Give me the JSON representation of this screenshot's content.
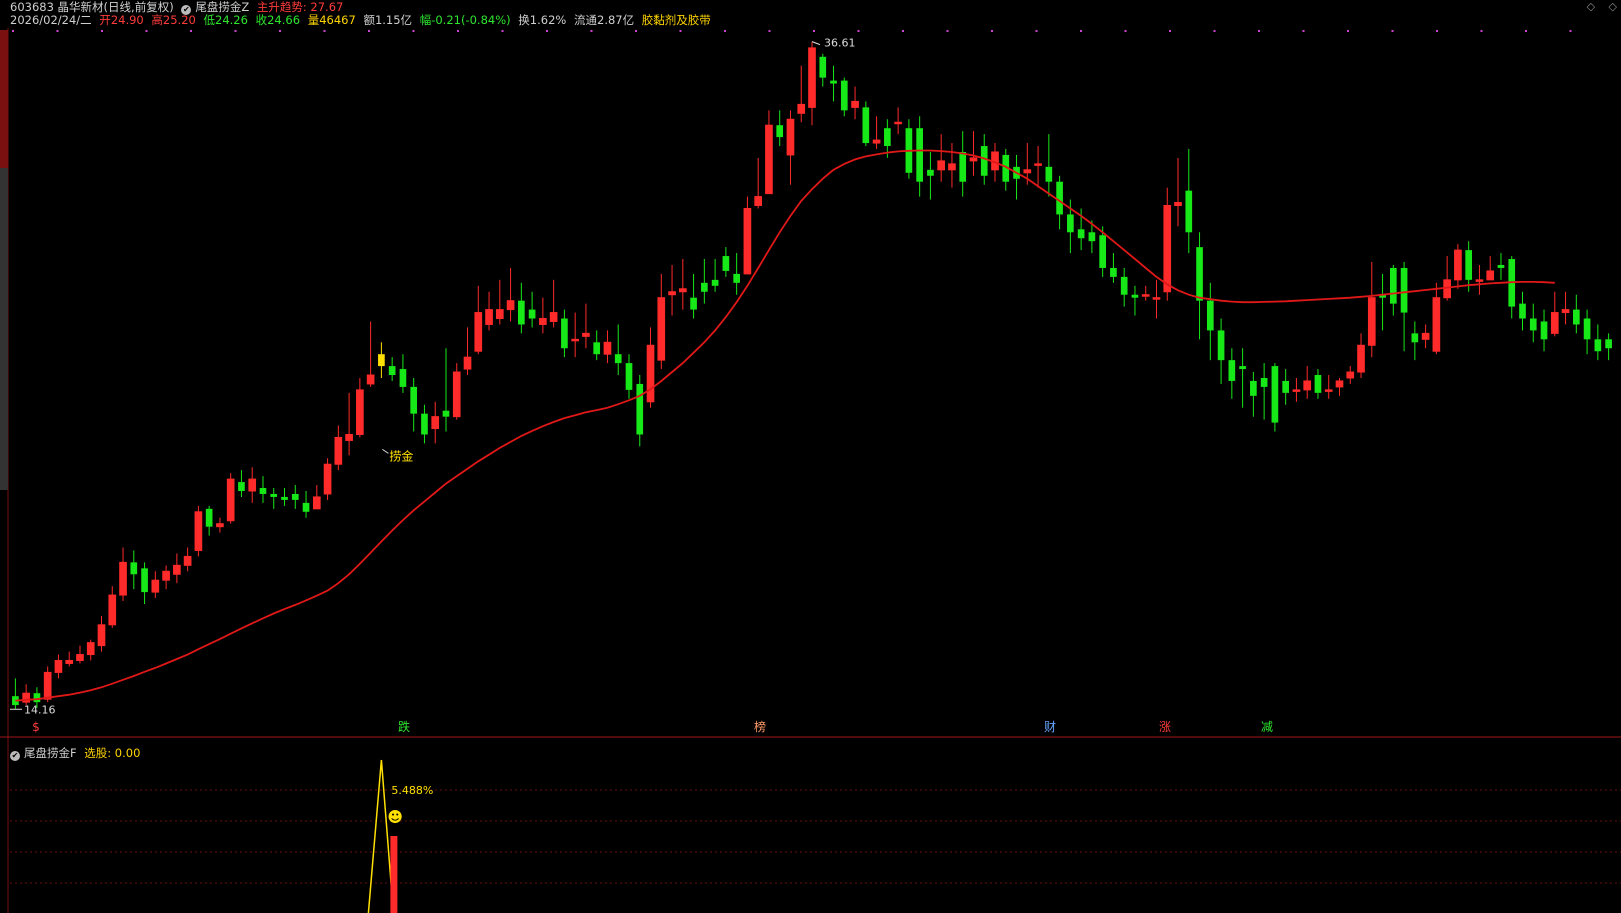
{
  "header": {
    "line1": {
      "code_name": "603683 晶华新材(日线,前复权)",
      "indicator": "尾盘捞金Z",
      "trend_label": "主升趋势: 27.67"
    },
    "line2": {
      "date": "2026/02/24/二",
      "open": "开24.90",
      "high": "高25.20",
      "low": "低24.26",
      "close": "收24.66",
      "volume": "量46467",
      "amount": "额1.15亿",
      "change": "幅-0.21(-0.84%)",
      "turnover": "换1.62%",
      "float": "流通2.87亿",
      "concept": "胶黏剂及胶带"
    }
  },
  "main_chart": {
    "max_label": "36.61",
    "min_label": "14.16",
    "signal_label": "捞金",
    "bottom_markers": [
      {
        "text": "$",
        "color": "#ff3b3b"
      },
      {
        "text": "跌",
        "color": "#2ee62e"
      },
      {
        "text": "榜",
        "color": "#ff9a66"
      },
      {
        "text": "财",
        "color": "#66a6ff"
      },
      {
        "text": "涨",
        "color": "#ff3b3b"
      },
      {
        "text": "减",
        "color": "#2ee62e"
      }
    ]
  },
  "sub_chart": {
    "title": "尾盘捞金F",
    "select_label": "选股: 0.00",
    "peak_label": "5.488%",
    "emoji": "☻"
  },
  "window_controls": [
    "◇",
    "◇"
  ],
  "colors": {
    "up": "#ff2a2a",
    "down": "#17e817",
    "ma": "#e01818",
    "signal": "#ffe000",
    "bg": "#000000"
  },
  "chart_data": {
    "type": "candlestick",
    "ma_label": "",
    "candles": [
      [
        14.6,
        14.3,
        15.2,
        14.16
      ],
      [
        14.4,
        14.7,
        15.0,
        14.3
      ],
      [
        14.7,
        14.4,
        14.9,
        14.2
      ],
      [
        14.5,
        15.4,
        15.6,
        14.4
      ],
      [
        15.4,
        15.8,
        16.0,
        15.2
      ],
      [
        15.7,
        15.8,
        16.1,
        15.6
      ],
      [
        15.8,
        16.0,
        16.3,
        15.7
      ],
      [
        16.0,
        16.4,
        16.5,
        15.8
      ],
      [
        16.3,
        17.0,
        17.3,
        16.1
      ],
      [
        17.0,
        18.0,
        18.3,
        16.9
      ],
      [
        18.0,
        19.1,
        19.6,
        17.8
      ],
      [
        19.1,
        18.7,
        19.5,
        18.2
      ],
      [
        18.9,
        18.1,
        19.1,
        17.7
      ],
      [
        18.1,
        18.5,
        18.8,
        17.9
      ],
      [
        18.5,
        18.8,
        19.0,
        18.2
      ],
      [
        18.7,
        19.0,
        19.4,
        18.4
      ],
      [
        19.0,
        19.3,
        19.6,
        18.8
      ],
      [
        19.5,
        20.8,
        21.0,
        19.3
      ],
      [
        20.9,
        20.3,
        21.0,
        20.0
      ],
      [
        20.3,
        20.4,
        20.6,
        20.1
      ],
      [
        20.5,
        21.9,
        22.1,
        20.4
      ],
      [
        21.8,
        21.5,
        22.2,
        21.3
      ],
      [
        21.5,
        21.9,
        22.3,
        21.1
      ],
      [
        21.6,
        21.4,
        22.0,
        21.1
      ],
      [
        21.4,
        21.3,
        21.6,
        20.9
      ],
      [
        21.3,
        21.2,
        21.6,
        21.0
      ],
      [
        21.4,
        21.2,
        21.7,
        20.9
      ],
      [
        21.1,
        20.8,
        21.5,
        20.6
      ],
      [
        20.9,
        21.3,
        21.7,
        20.9
      ],
      [
        21.4,
        22.4,
        22.6,
        21.2
      ],
      [
        22.4,
        23.3,
        23.7,
        22.2
      ],
      [
        23.2,
        23.4,
        24.8,
        22.7
      ],
      [
        23.4,
        24.9,
        25.3,
        23.3
      ],
      [
        25.1,
        25.4,
        27.2,
        25.0
      ],
      [
        26.1,
        25.7,
        26.5,
        25.3
      ],
      [
        25.7,
        25.4,
        26.0,
        25.2
      ],
      [
        25.6,
        25.0,
        26.1,
        24.8
      ],
      [
        25.0,
        24.1,
        25.3,
        23.5
      ],
      [
        24.1,
        23.4,
        24.4,
        23.1
      ],
      [
        23.6,
        24.0,
        24.5,
        23.1
      ],
      [
        24.2,
        24.0,
        26.3,
        23.5
      ],
      [
        24.0,
        25.5,
        25.8,
        23.9
      ],
      [
        25.6,
        26.0,
        27.0,
        25.4
      ],
      [
        26.2,
        27.5,
        28.4,
        26.1
      ],
      [
        27.1,
        27.6,
        28.2,
        26.9
      ],
      [
        27.3,
        27.6,
        28.6,
        27.1
      ],
      [
        27.6,
        27.9,
        29.0,
        27.2
      ],
      [
        27.9,
        27.1,
        28.5,
        26.8
      ],
      [
        27.6,
        27.3,
        28.2,
        27.0
      ],
      [
        27.1,
        27.3,
        28.0,
        26.8
      ],
      [
        27.2,
        27.5,
        28.6,
        27.0
      ],
      [
        27.3,
        26.3,
        27.6,
        26.0
      ],
      [
        26.6,
        26.6,
        27.5,
        26.0
      ],
      [
        26.7,
        26.8,
        27.8,
        26.3
      ],
      [
        26.5,
        26.1,
        26.9,
        25.9
      ],
      [
        26.1,
        26.5,
        26.9,
        25.8
      ],
      [
        26.1,
        25.8,
        27.1,
        25.4
      ],
      [
        25.8,
        24.9,
        26.1,
        24.6
      ],
      [
        25.1,
        23.4,
        25.4,
        23.0
      ],
      [
        24.5,
        26.4,
        27.0,
        24.3
      ],
      [
        25.9,
        28.0,
        28.8,
        25.6
      ],
      [
        28.1,
        28.2,
        29.1,
        27.4
      ],
      [
        28.2,
        28.3,
        29.3,
        27.6
      ],
      [
        28.0,
        27.6,
        28.8,
        27.3
      ],
      [
        28.5,
        28.2,
        29.3,
        27.8
      ],
      [
        28.6,
        28.4,
        29.3,
        28.2
      ],
      [
        29.4,
        28.9,
        29.7,
        28.7
      ],
      [
        28.8,
        28.5,
        29.5,
        28.1
      ],
      [
        28.8,
        31.0,
        31.4,
        28.8
      ],
      [
        31.1,
        31.4,
        32.7,
        31.0
      ],
      [
        31.5,
        33.8,
        34.3,
        31.5
      ],
      [
        33.8,
        33.4,
        34.3,
        33.1
      ],
      [
        32.8,
        34.0,
        34.3,
        31.8
      ],
      [
        34.2,
        34.5,
        35.8,
        33.9
      ],
      [
        34.4,
        36.4,
        36.61,
        33.8
      ],
      [
        36.1,
        35.4,
        36.2,
        35.1
      ],
      [
        35.3,
        35.2,
        35.8,
        34.6
      ],
      [
        35.3,
        34.3,
        35.4,
        34.1
      ],
      [
        34.4,
        34.6,
        35.1,
        34.0
      ],
      [
        34.4,
        33.2,
        34.6,
        33.1
      ],
      [
        33.2,
        33.3,
        34.1,
        33.0
      ],
      [
        33.7,
        33.1,
        34.0,
        32.7
      ],
      [
        33.9,
        33.9,
        34.4,
        33.5
      ],
      [
        33.7,
        32.2,
        34.0,
        32.0
      ],
      [
        33.7,
        31.9,
        34.1,
        31.4
      ],
      [
        32.3,
        32.1,
        32.9,
        31.3
      ],
      [
        32.3,
        32.6,
        33.5,
        31.9
      ],
      [
        32.3,
        32.5,
        33.2,
        31.7
      ],
      [
        32.9,
        31.9,
        33.6,
        31.4
      ],
      [
        32.6,
        32.7,
        33.6,
        32.1
      ],
      [
        33.1,
        32.1,
        33.5,
        31.8
      ],
      [
        32.3,
        32.9,
        33.2,
        31.9
      ],
      [
        32.8,
        31.9,
        33.0,
        31.6
      ],
      [
        32.4,
        32.0,
        32.8,
        31.3
      ],
      [
        32.2,
        32.3,
        33.2,
        31.8
      ],
      [
        32.5,
        32.5,
        33.1,
        31.7
      ],
      [
        32.4,
        31.9,
        33.5,
        31.4
      ],
      [
        31.9,
        30.8,
        32.1,
        30.3
      ],
      [
        30.8,
        30.2,
        31.3,
        29.5
      ],
      [
        30.3,
        30.0,
        31.0,
        29.6
      ],
      [
        30.2,
        29.9,
        30.6,
        29.5
      ],
      [
        30.1,
        29.0,
        30.4,
        28.7
      ],
      [
        29.0,
        28.7,
        29.5,
        28.5
      ],
      [
        28.7,
        28.1,
        29.0,
        27.7
      ],
      [
        28.1,
        28.0,
        28.4,
        27.4
      ],
      [
        28.1,
        28.1,
        28.4,
        27.9
      ],
      [
        28.0,
        28.0,
        28.6,
        27.3
      ],
      [
        28.2,
        31.1,
        31.7,
        27.9
      ],
      [
        31.1,
        31.2,
        32.7,
        30.4
      ],
      [
        31.6,
        30.2,
        33.0,
        29.5
      ],
      [
        29.7,
        27.9,
        30.2,
        26.6
      ],
      [
        27.9,
        26.9,
        28.5,
        25.9
      ],
      [
        26.9,
        25.9,
        27.3,
        25.1
      ],
      [
        25.9,
        25.2,
        26.3,
        24.6
      ],
      [
        25.7,
        25.6,
        26.3,
        24.3
      ],
      [
        25.2,
        24.7,
        25.5,
        24.0
      ],
      [
        25.3,
        25.0,
        25.8,
        23.9
      ],
      [
        25.7,
        23.8,
        25.8,
        23.5
      ],
      [
        25.2,
        24.8,
        25.6,
        24.4
      ],
      [
        24.9,
        24.9,
        25.3,
        24.5
      ],
      [
        24.9,
        25.2,
        25.7,
        24.6
      ],
      [
        25.4,
        24.8,
        25.6,
        24.6
      ],
      [
        24.9,
        24.9,
        25.4,
        24.6
      ],
      [
        25.0,
        25.2,
        25.3,
        24.7
      ],
      [
        25.3,
        25.5,
        25.7,
        25.1
      ],
      [
        25.5,
        26.4,
        26.8,
        25.3
      ],
      [
        26.4,
        28.0,
        29.2,
        26.0
      ],
      [
        28.1,
        28.0,
        28.8,
        26.9
      ],
      [
        29.0,
        27.8,
        29.1,
        27.4
      ],
      [
        29.0,
        27.5,
        29.2,
        26.2
      ],
      [
        26.8,
        26.5,
        27.2,
        25.9
      ],
      [
        26.6,
        26.8,
        27.1,
        26.3
      ],
      [
        26.2,
        28.0,
        28.5,
        26.1
      ],
      [
        28.0,
        28.6,
        29.4,
        27.9
      ],
      [
        28.6,
        29.6,
        29.8,
        28.3
      ],
      [
        29.6,
        28.6,
        29.9,
        28.2
      ],
      [
        28.6,
        28.6,
        29.1,
        28.1
      ],
      [
        28.6,
        28.9,
        29.4,
        28.6
      ],
      [
        29.1,
        29.0,
        29.5,
        28.6
      ],
      [
        29.3,
        27.7,
        29.4,
        27.3
      ],
      [
        27.8,
        27.3,
        28.2,
        26.9
      ],
      [
        27.3,
        26.9,
        27.8,
        26.5
      ],
      [
        27.2,
        26.6,
        27.6,
        26.2
      ],
      [
        26.8,
        27.5,
        28.2,
        26.7
      ],
      [
        27.5,
        27.6,
        28.2,
        27.1
      ],
      [
        27.6,
        27.1,
        28.1,
        26.8
      ],
      [
        27.3,
        26.6,
        27.6,
        26.1
      ],
      [
        26.6,
        26.2,
        27.1,
        25.9
      ],
      [
        26.6,
        26.3,
        26.8,
        25.9
      ]
    ],
    "ma": [
      14.45,
      14.48,
      14.5,
      14.55,
      14.6,
      14.65,
      14.72,
      14.8,
      14.9,
      15.02,
      15.15,
      15.28,
      15.42,
      15.55,
      15.7,
      15.85,
      16.0,
      16.18,
      16.35,
      16.52,
      16.7,
      16.88,
      17.05,
      17.22,
      17.38,
      17.53,
      17.67,
      17.82,
      17.98,
      18.15,
      18.4,
      18.7,
      19.05,
      19.42,
      19.8,
      20.17,
      20.52,
      20.85,
      21.15,
      21.45,
      21.75,
      22.0,
      22.25,
      22.5,
      22.72,
      22.95,
      23.15,
      23.35,
      23.52,
      23.68,
      23.82,
      23.95,
      24.05,
      24.15,
      24.22,
      24.3,
      24.42,
      24.55,
      24.7,
      24.92,
      25.2,
      25.5,
      25.8,
      26.15,
      26.5,
      26.9,
      27.35,
      27.85,
      28.4,
      29.0,
      29.6,
      30.2,
      30.75,
      31.25,
      31.65,
      32.0,
      32.3,
      32.5,
      32.65,
      32.75,
      32.82,
      32.88,
      32.92,
      32.94,
      32.95,
      32.95,
      32.93,
      32.9,
      32.85,
      32.78,
      32.68,
      32.55,
      32.4,
      32.2,
      32.0,
      31.75,
      31.5,
      31.25,
      31.0,
      30.75,
      30.48,
      30.2,
      29.9,
      29.6,
      29.3,
      29.0,
      28.7,
      28.45,
      28.25,
      28.1,
      28.0,
      27.95,
      27.9,
      27.87,
      27.85,
      27.85,
      27.86,
      27.87,
      27.88,
      27.9,
      27.92,
      27.94,
      27.96,
      27.98,
      28.0,
      28.03,
      28.06,
      28.1,
      28.14,
      28.18,
      28.22,
      28.26,
      28.3,
      28.34,
      28.38,
      28.42,
      28.45,
      28.48,
      28.5,
      28.52,
      28.53,
      28.53,
      28.52,
      28.5
    ]
  }
}
